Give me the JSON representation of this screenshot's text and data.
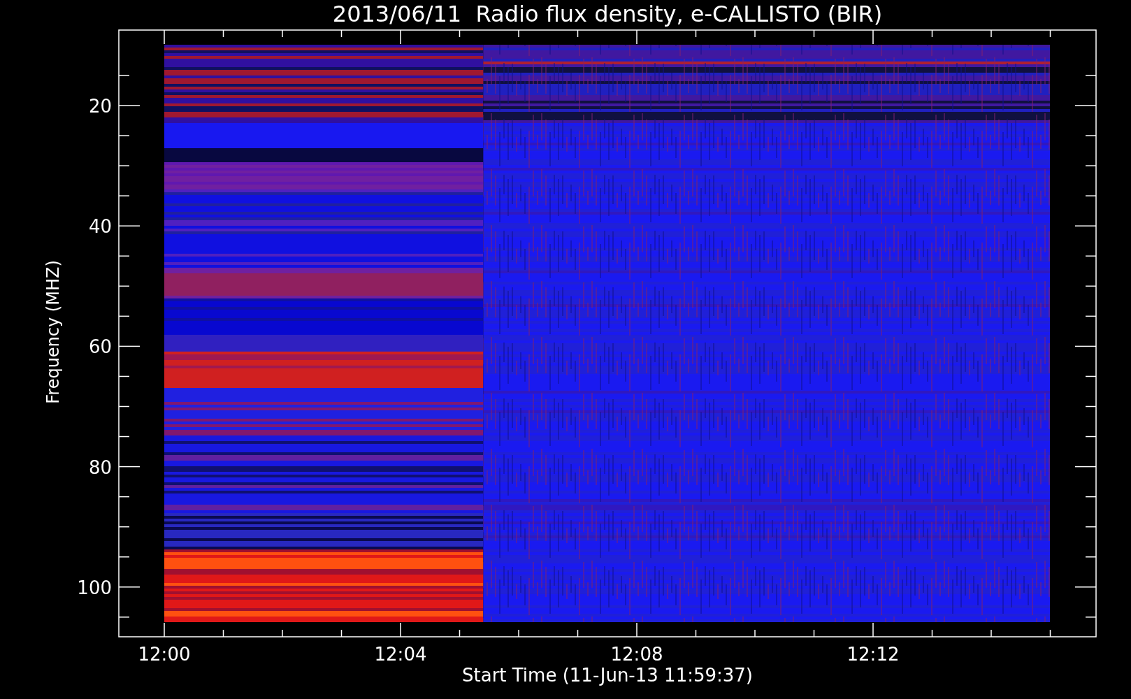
{
  "title": "2013/06/11  Radio flux density, e-CALLISTO (BIR)",
  "y_axis": {
    "title": "Frequency (MHZ)",
    "ticks": [
      "20",
      "40",
      "60",
      "80",
      "100"
    ]
  },
  "x_axis": {
    "title": "Start Time (11-Jun-13 11:59:37)",
    "ticks": [
      "12:00",
      "12:04",
      "12:08",
      "12:12"
    ]
  }
}
